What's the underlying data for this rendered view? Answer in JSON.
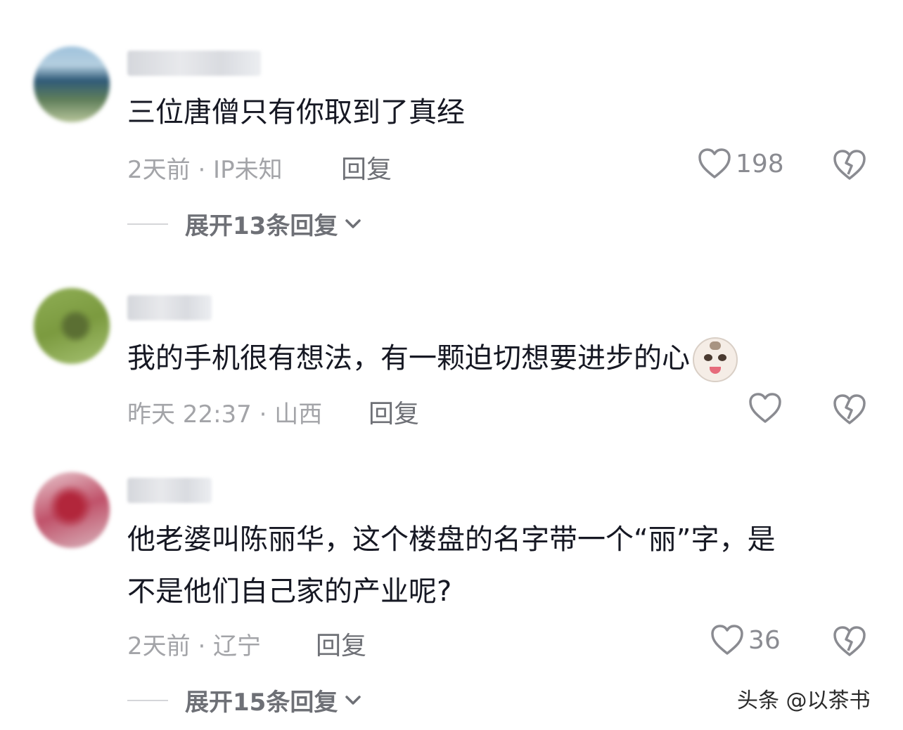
{
  "comments": [
    {
      "text": "三位唐僧只有你取到了真经",
      "meta": "2天前 · IP未知",
      "reply_label": "回复",
      "likes": "198",
      "expand_label": "展开13条回复"
    },
    {
      "text": "我的手机很有想法，有一颗迫切想要进步的心",
      "meta": "昨天 22:37 · 山西",
      "reply_label": "回复",
      "likes": "",
      "emoji": "cat-emoji"
    },
    {
      "text_line1": "他老婆叫陈丽华，这个楼盘的名字带一个“丽”字，是",
      "text_line2": "不是他们自己家的产业呢?",
      "meta": "2天前 · 辽宁",
      "reply_label": "回复",
      "likes": "36",
      "expand_label": "展开15条回复"
    }
  ],
  "watermark": "头条 @以茶书",
  "colors": {
    "text": "#161823",
    "meta": "#a3a4a8",
    "icon": "#8a8b91"
  },
  "icons": [
    "heart-icon",
    "broken-heart-icon",
    "chevron-down-icon"
  ]
}
